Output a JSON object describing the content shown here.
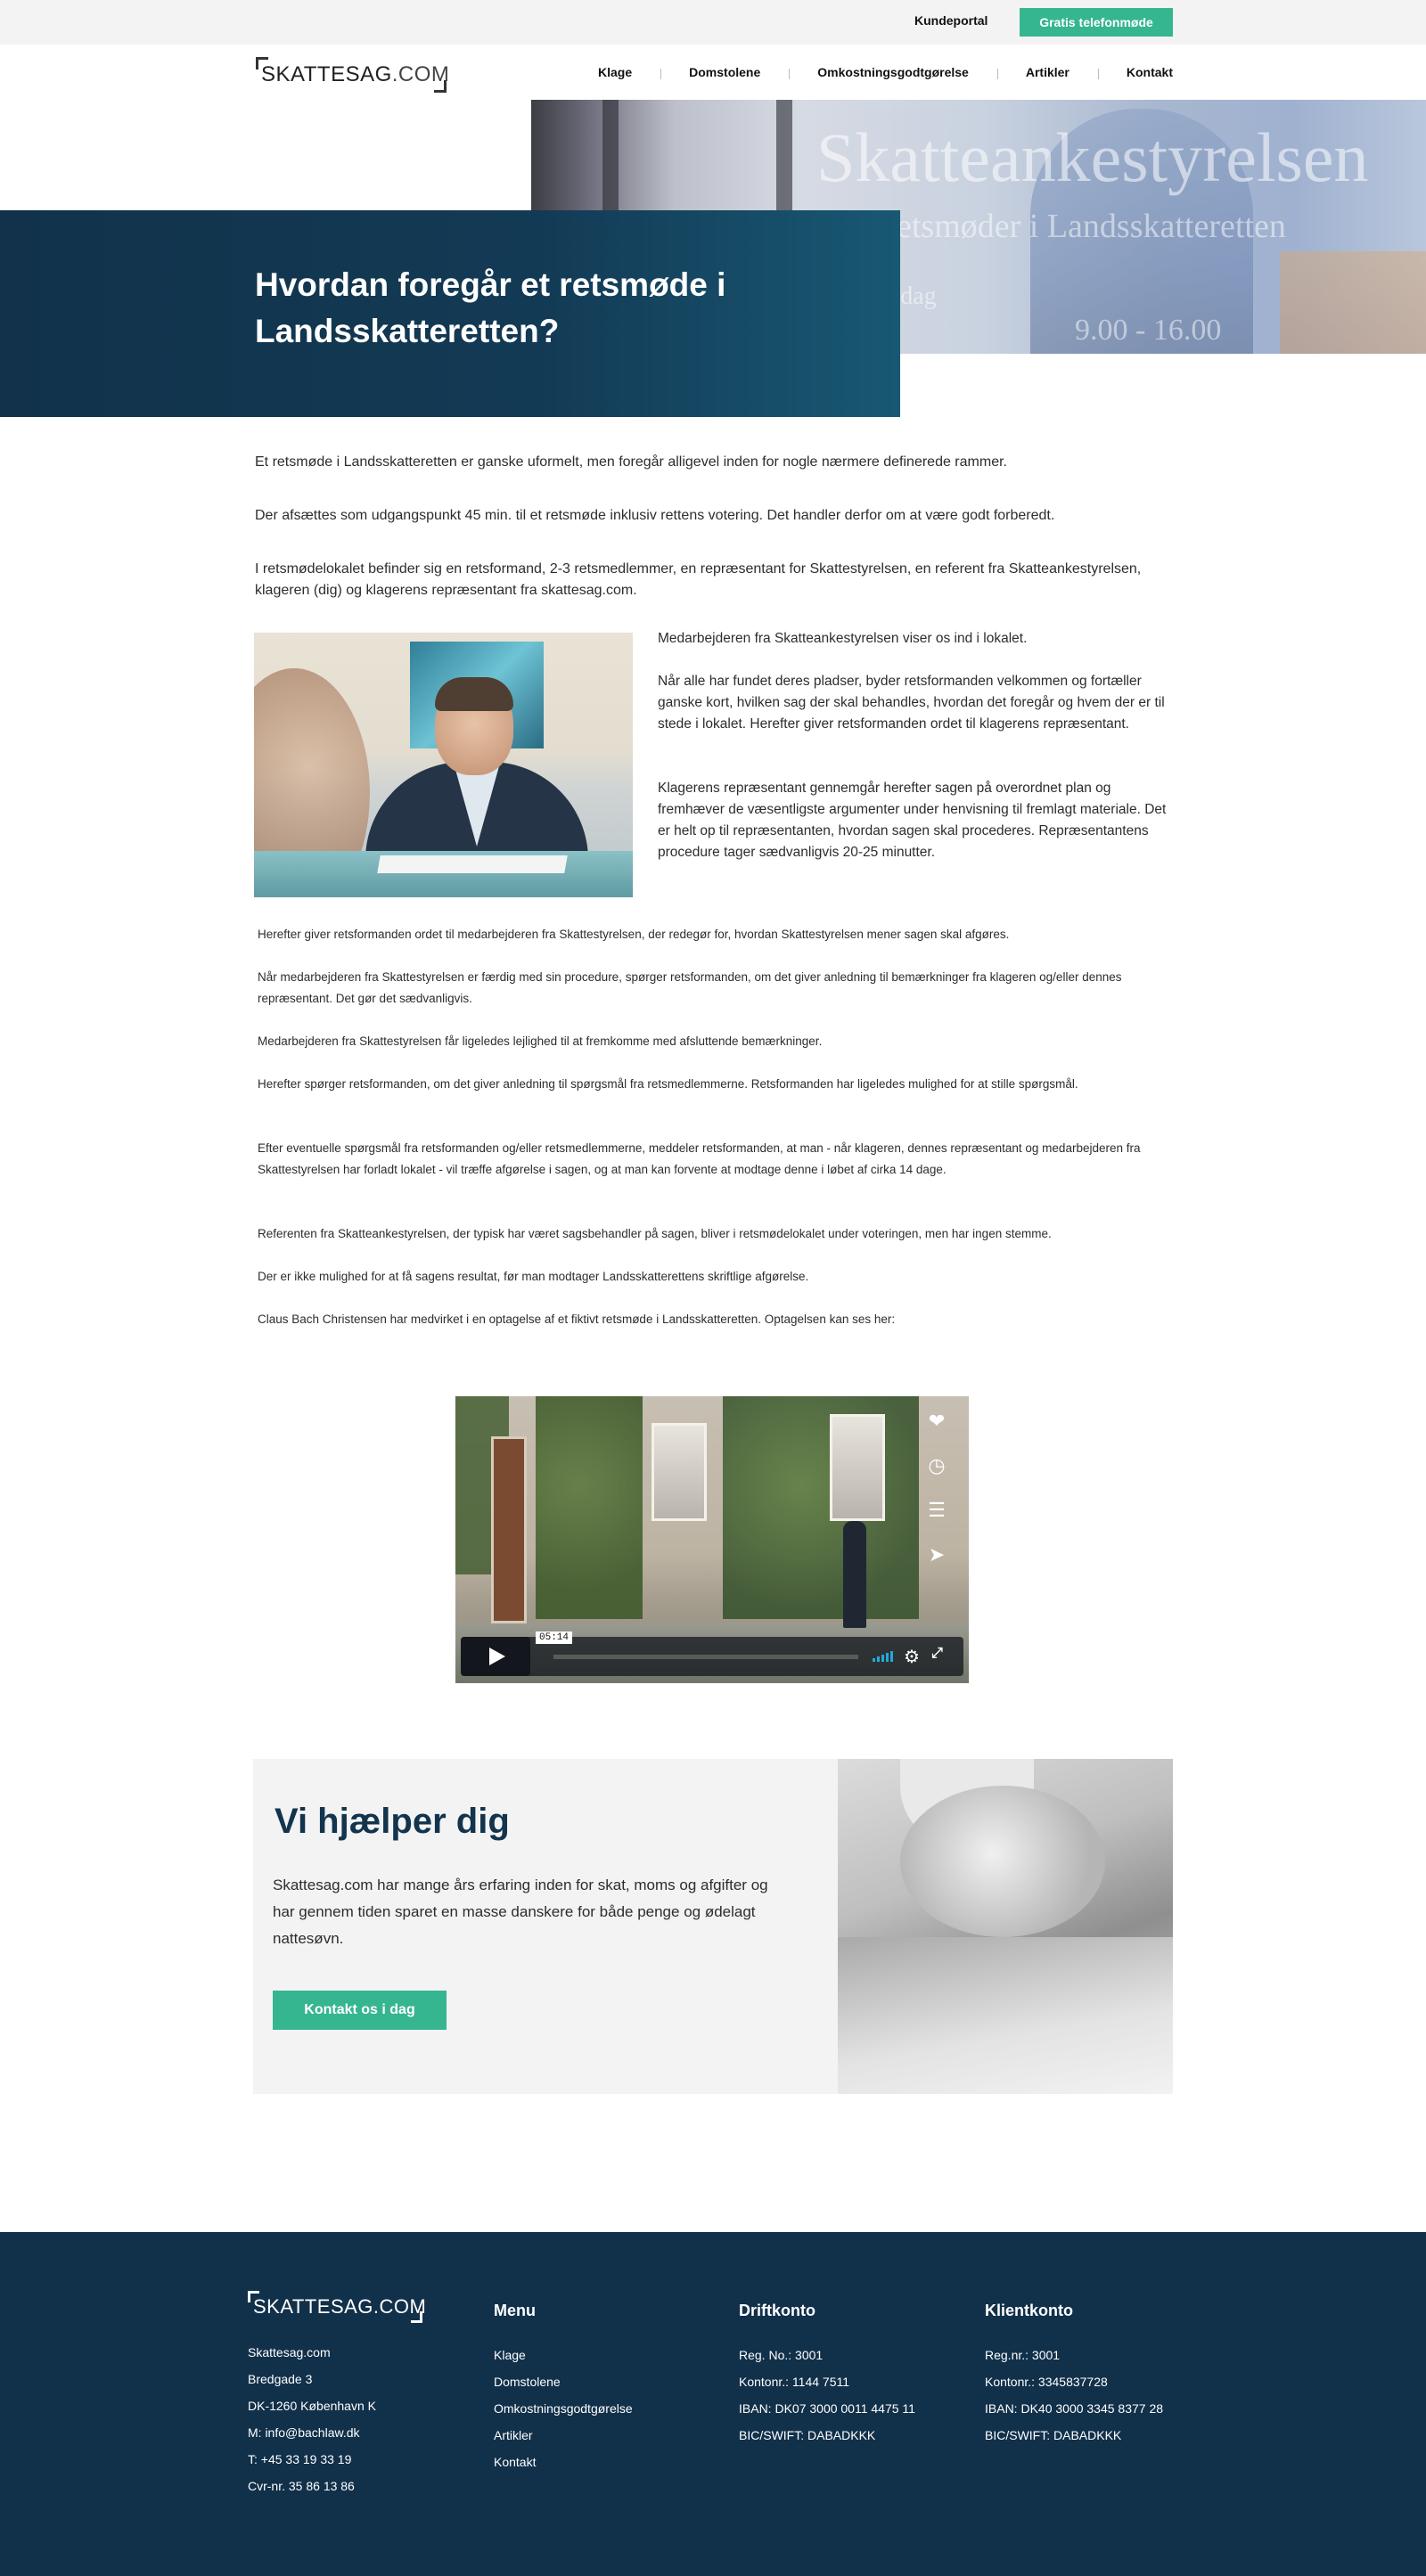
{
  "topbar": {
    "kundeportal": "Kundeportal",
    "gratis": "Gratis telefonmøde"
  },
  "logo": {
    "name": "SKATTESAG",
    "domain": ".COM"
  },
  "nav": {
    "items": [
      "Klage",
      "Domstolene",
      "Omkostningsgodtgørelse",
      "Artikler",
      "Kontakt"
    ]
  },
  "hero": {
    "title": "Hvordan foregår et retsmøde i Landsskatteretten?",
    "glass_text": "Skatteankestyrelsen",
    "glass_sub": "etsmøder i Landsskatteretten",
    "glass_day": "orsdag",
    "glass_time": "9.00 - 16.00"
  },
  "article": {
    "intro": [
      "Et retsmøde i Landsskatteretten er ganske uformelt, men foregår alligevel inden for nogle nærmere definerede rammer.",
      "Der afsættes som udgangspunkt 45 min. til et retsmøde inklusiv rettens votering. Det handler derfor om at være godt forberedt.",
      "I retsmødelokalet befinder sig en retsformand, 2-3 retsmedlemmer, en repræsentant for Skattestyrelsen, en referent fra Skatteankestyrelsen, klageren (dig) og klagerens repræsentant fra skattesag.com."
    ],
    "side": [
      "Medarbejderen fra Skatteankestyrelsen viser os ind i lokalet.",
      "Når alle har fundet deres pladser, byder retsformanden velkommen og fortæller ganske kort, hvilken sag der skal behandles, hvordan det foregår og hvem der er til stede i lokalet. Herefter giver retsformanden ordet til klagerens repræsentant.",
      "Klagerens repræsentant gennemgår herefter sagen på overordnet plan og fremhæver de væsentligste argumenter under henvisning til fremlagt materiale. Det er helt op til repræsentanten, hvordan sagen skal procederes. Repræsentantens procedure tager sædvanligvis 20-25 minutter."
    ],
    "small": [
      "Herefter giver retsformanden ordet til medarbejderen fra Skattestyrelsen, der redegør for, hvordan Skattestyrelsen mener sagen skal afgøres.",
      "Når medarbejderen fra Skattestyrelsen er færdig med sin procedure, spørger retsformanden, om det giver anledning til bemærkninger fra klageren og/eller dennes repræsentant. Det gør det sædvanligvis.",
      "Medarbejderen fra Skattestyrelsen får ligeledes lejlighed til at fremkomme med afsluttende bemærkninger.",
      "Herefter spørger retsformanden, om det giver anledning til spørgsmål fra retsmedlemmerne. Retsformanden har ligeledes mulighed for at stille spørgsmål.",
      "Efter eventuelle spørgsmål fra retsformanden og/eller retsmedlemmerne, meddeler retsformanden, at man - når klageren, dennes repræsentant og medarbejderen fra Skattestyrelsen har forladt lokalet - vil træffe afgørelse i sagen, og at man kan forvente at modtage denne i løbet af cirka 14 dage.",
      "Referenten fra Skatteankestyrelsen, der typisk har været sagsbehandler på sagen, bliver i retsmødelokalet under voteringen, men har ingen stemme.",
      "Der er ikke mulighed for at få sagens resultat, før man modtager Landsskatterettens skriftlige afgørelse.",
      "Claus Bach Christensen har medvirket i en optagelse af et fiktivt retsmøde i Landsskatteretten. Optagelsen kan ses her:"
    ]
  },
  "video": {
    "duration": "05:14",
    "icons": [
      "heart-icon",
      "clock-icon",
      "layers-icon",
      "send-icon"
    ]
  },
  "cta": {
    "title": "Vi hjælper dig",
    "text": "Skattesag.com har mange års erfaring inden for skat, moms og afgifter og har gennem tiden sparet en masse danskere for både penge og ødelagt nattesøvn.",
    "button": "Kontakt os i dag"
  },
  "footer": {
    "address": [
      "Skattesag.com",
      "Bredgade 3",
      "DK-1260 København K",
      "M: info@bachlaw.dk",
      "T: +45 33 19 33 19",
      "Cvr-nr. 35 86 13 86"
    ],
    "menu": {
      "title": "Menu",
      "items": [
        "Klage",
        "Domstolene",
        "Omkostningsgodtgørelse",
        "Artikler",
        "Kontakt"
      ]
    },
    "drift": {
      "title": "Driftkonto",
      "items": [
        "Reg. No.: 3001",
        "Kontonr.: 1144 7511",
        "IBAN: DK07 3000 0011 4475 11",
        "BIC/SWIFT: DABADKKK"
      ]
    },
    "klient": {
      "title": "Klientkonto",
      "items": [
        "Reg.nr.: 3001",
        "Kontonr.: 3345837728",
        "IBAN: DK40 3000 3345 8377 28",
        "BIC/SWIFT: DABADKKK"
      ]
    }
  },
  "colors": {
    "accent": "#36b591",
    "navy": "#11304a",
    "hero_box": "#133a55",
    "topbar_bg": "#f3f3f3"
  }
}
